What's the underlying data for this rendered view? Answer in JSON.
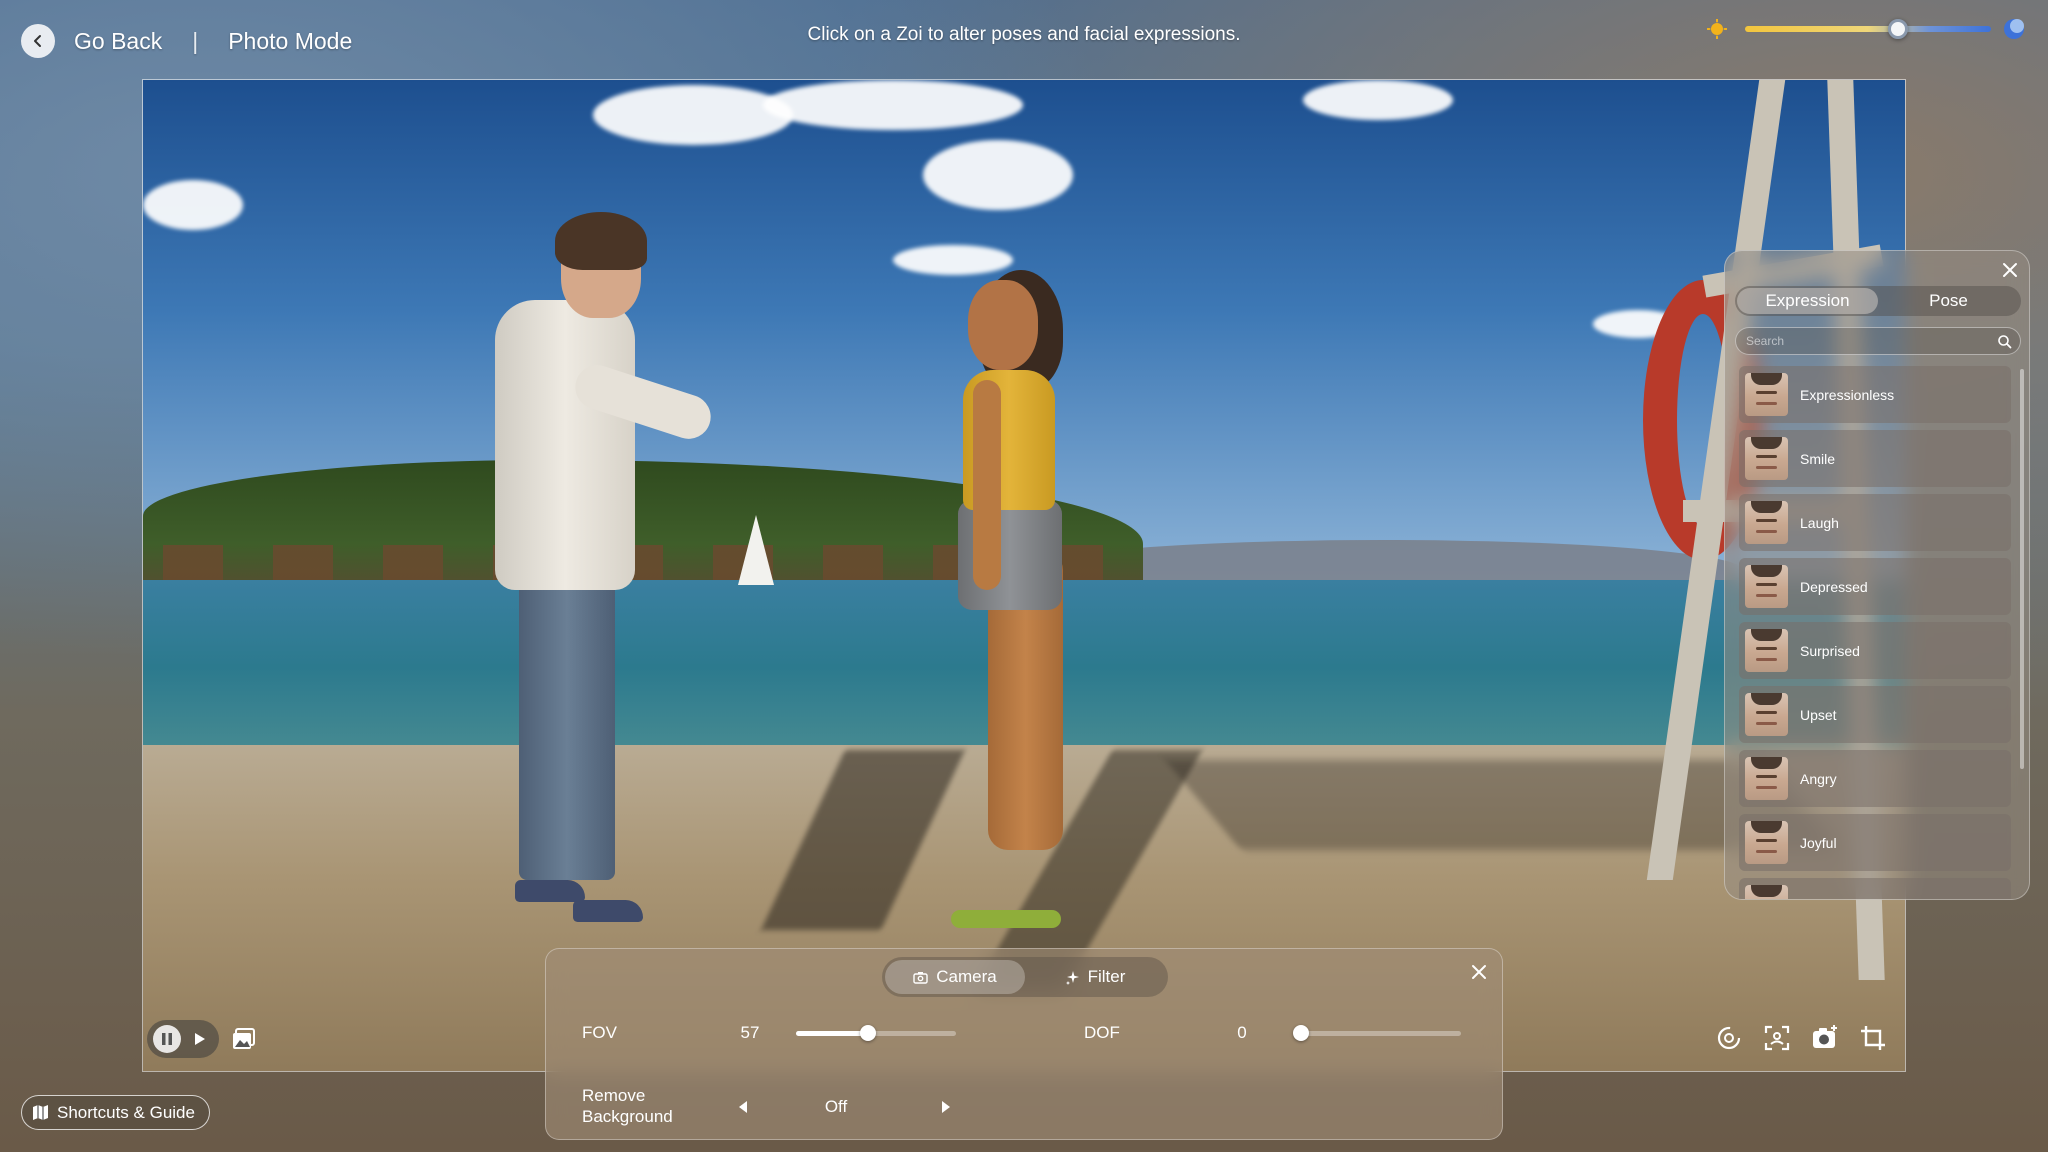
{
  "header": {
    "back_label": "Go Back",
    "separator": "|",
    "mode_title": "Photo Mode",
    "hint": "Click on a Zoi to alter poses and facial expressions."
  },
  "time_of_day": {
    "icons": [
      "sun-icon",
      "moon-icon"
    ],
    "level": 0.62
  },
  "expression_panel": {
    "tabs": [
      {
        "label": "Expression",
        "active": true
      },
      {
        "label": "Pose",
        "active": false
      }
    ],
    "search_placeholder": "Search",
    "items": [
      {
        "label": "Expressionless"
      },
      {
        "label": "Smile"
      },
      {
        "label": "Laugh"
      },
      {
        "label": "Depressed"
      },
      {
        "label": "Surprised"
      },
      {
        "label": "Upset"
      },
      {
        "label": "Angry"
      },
      {
        "label": "Joyful"
      }
    ]
  },
  "camera_panel": {
    "tabs": [
      {
        "label": "Camera",
        "icon": "camera-icon",
        "active": true
      },
      {
        "label": "Filter",
        "icon": "sparkle-icon",
        "active": false
      }
    ],
    "fov": {
      "label": "FOV",
      "value": 57,
      "level": 0.45
    },
    "dof": {
      "label": "DOF",
      "value": 0,
      "level": 0.0
    },
    "remove_background": {
      "label": "Remove Background",
      "value": "Off"
    }
  },
  "footer": {
    "shortcuts_label": "Shortcuts & Guide"
  },
  "colors": {
    "sun": "#f2b21b",
    "moon": "#3d72d9",
    "panel_bg": "#a08c76"
  }
}
